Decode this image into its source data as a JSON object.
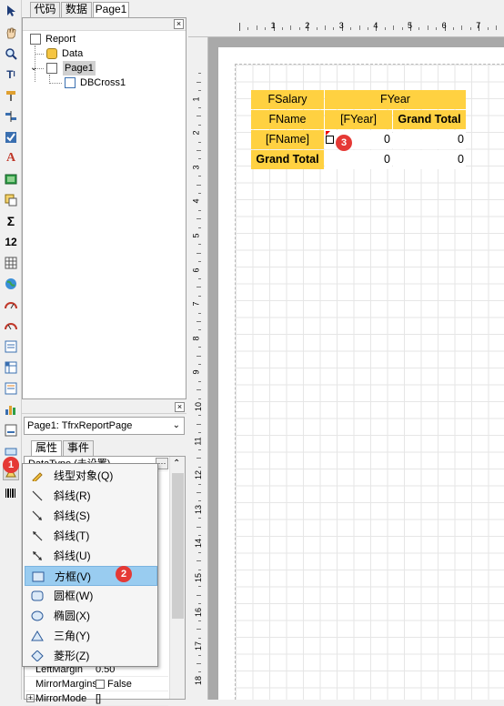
{
  "tabs": [
    "代码",
    "数据",
    "Page1"
  ],
  "tree": {
    "root": "Report",
    "data": "Data",
    "page": "Page1",
    "object": "DBCross1"
  },
  "page_selector": "Page1: TfrxReportPage",
  "prop_tabs": [
    "属性",
    "事件"
  ],
  "props": {
    "partial_first": "DataType (未设置)",
    "left_margin_label": "LeftMargin",
    "left_margin_value": "0.50",
    "mirror_margins_label": "MirrorMargins",
    "mirror_margins_value": "False",
    "mirror_mode_label": "MirrorMode",
    "mirror_mode_value": "[]",
    "expand": "+"
  },
  "menu": {
    "items": [
      {
        "label": "线型对象(Q)",
        "icon": "pencil-icon"
      },
      {
        "label": "斜线(R)",
        "icon": "line-diagonal-icon"
      },
      {
        "label": "斜线(S)",
        "icon": "arrow-down-right-icon"
      },
      {
        "label": "斜线(T)",
        "icon": "arrow-up-left-icon"
      },
      {
        "label": "斜线(U)",
        "icon": "arrow-both-icon"
      },
      {
        "label": "方框(V)",
        "icon": "rectangle-icon"
      },
      {
        "label": "圆框(W)",
        "icon": "rounded-rectangle-icon"
      },
      {
        "label": "椭圆(X)",
        "icon": "ellipse-icon"
      },
      {
        "label": "三角(Y)",
        "icon": "triangle-icon"
      },
      {
        "label": "菱形(Z)",
        "icon": "diamond-icon"
      }
    ],
    "highlight_index": 5
  },
  "ruler_h": [
    "1",
    "2",
    "3",
    "4",
    "5",
    "6",
    "7"
  ],
  "ruler_v": [
    "1",
    "2",
    "3",
    "4",
    "5",
    "6",
    "7",
    "8",
    "9",
    "10",
    "11",
    "12",
    "13",
    "14",
    "15",
    "16",
    "17",
    "18"
  ],
  "crosstab": {
    "r1c1": "FSalary",
    "r1c2": "FYear",
    "r2c1": "FName",
    "r2c2": "[FYear]",
    "r2c3": "Grand Total",
    "r3c1": "[FName]",
    "r3c2": "0",
    "r3c3": "0",
    "r4c1": "Grand Total",
    "r4c2": "0",
    "r4c3": "0"
  },
  "badges": [
    "1",
    "2",
    "3"
  ],
  "colors": {
    "header_yellow": "#ffd141",
    "highlight_blue": "#99ccf0",
    "badge_red": "#e53935"
  }
}
